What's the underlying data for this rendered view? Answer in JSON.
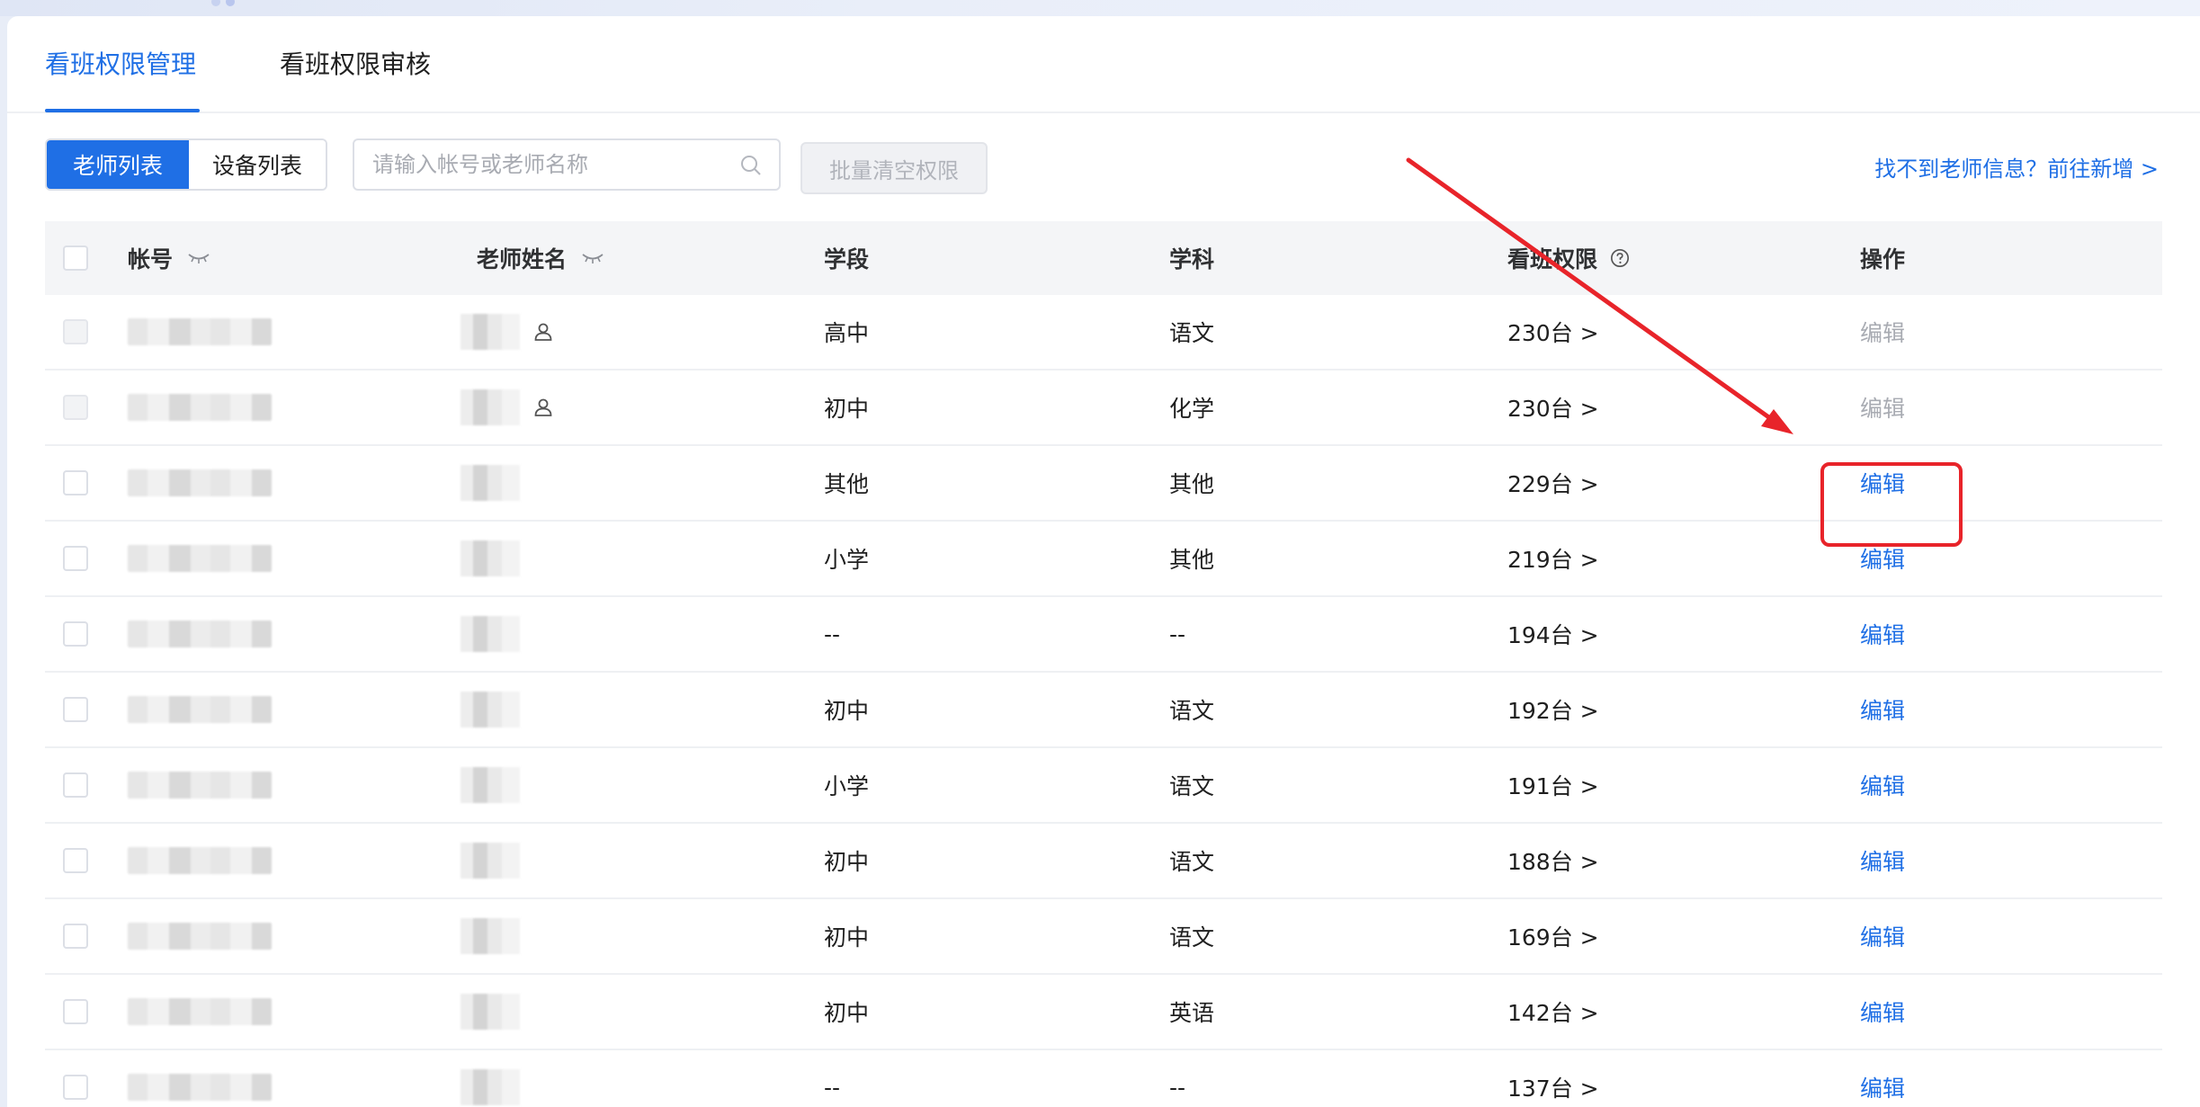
{
  "tabs": [
    {
      "label": "看班权限管理",
      "active": true
    },
    {
      "label": "看班权限审核",
      "active": false
    }
  ],
  "toolbar": {
    "view_toggle": [
      {
        "label": "老师列表",
        "active": true
      },
      {
        "label": "设备列表",
        "active": false
      }
    ],
    "search_placeholder": "请输入帐号或老师名称",
    "batch_clear_label": "批量清空权限",
    "missing_teacher_link": "找不到老师信息？前往新增 >"
  },
  "table": {
    "headers": {
      "account": "帐号",
      "teacher_name": "老师姓名",
      "stage": "学段",
      "subject": "学科",
      "permission": "看班权限",
      "action": "操作"
    },
    "rows": [
      {
        "stage": "高中",
        "subject": "语文",
        "permission": "230台 >",
        "action": "编辑",
        "action_enabled": false,
        "checkbox_enabled": false,
        "user_icon": true
      },
      {
        "stage": "初中",
        "subject": "化学",
        "permission": "230台 >",
        "action": "编辑",
        "action_enabled": false,
        "checkbox_enabled": false,
        "user_icon": true
      },
      {
        "stage": "其他",
        "subject": "其他",
        "permission": "229台 >",
        "action": "编辑",
        "action_enabled": true,
        "checkbox_enabled": true,
        "user_icon": false
      },
      {
        "stage": "小学",
        "subject": "其他",
        "permission": "219台 >",
        "action": "编辑",
        "action_enabled": true,
        "checkbox_enabled": true,
        "user_icon": false
      },
      {
        "stage": "--",
        "subject": "--",
        "permission": "194台 >",
        "action": "编辑",
        "action_enabled": true,
        "checkbox_enabled": true,
        "user_icon": false
      },
      {
        "stage": "初中",
        "subject": "语文",
        "permission": "192台 >",
        "action": "编辑",
        "action_enabled": true,
        "checkbox_enabled": true,
        "user_icon": false
      },
      {
        "stage": "小学",
        "subject": "语文",
        "permission": "191台 >",
        "action": "编辑",
        "action_enabled": true,
        "checkbox_enabled": true,
        "user_icon": false
      },
      {
        "stage": "初中",
        "subject": "语文",
        "permission": "188台 >",
        "action": "编辑",
        "action_enabled": true,
        "checkbox_enabled": true,
        "user_icon": false
      },
      {
        "stage": "初中",
        "subject": "语文",
        "permission": "169台 >",
        "action": "编辑",
        "action_enabled": true,
        "checkbox_enabled": true,
        "user_icon": false
      },
      {
        "stage": "初中",
        "subject": "英语",
        "permission": "142台 >",
        "action": "编辑",
        "action_enabled": true,
        "checkbox_enabled": true,
        "user_icon": false
      },
      {
        "stage": "--",
        "subject": "--",
        "permission": "137台 >",
        "action": "编辑",
        "action_enabled": true,
        "checkbox_enabled": true,
        "user_icon": false
      }
    ]
  },
  "annotation": {
    "arrow_color": "#e8242a",
    "highlight_color": "#e8242a"
  },
  "colors": {
    "accent": "#1f6fe5",
    "muted_text": "#a8abb2",
    "header_bg": "#f4f5f7"
  },
  "icons": {
    "search": "search-icon",
    "eye_closed": "eye-closed-icon",
    "help": "help-circle-icon",
    "user": "user-icon"
  }
}
